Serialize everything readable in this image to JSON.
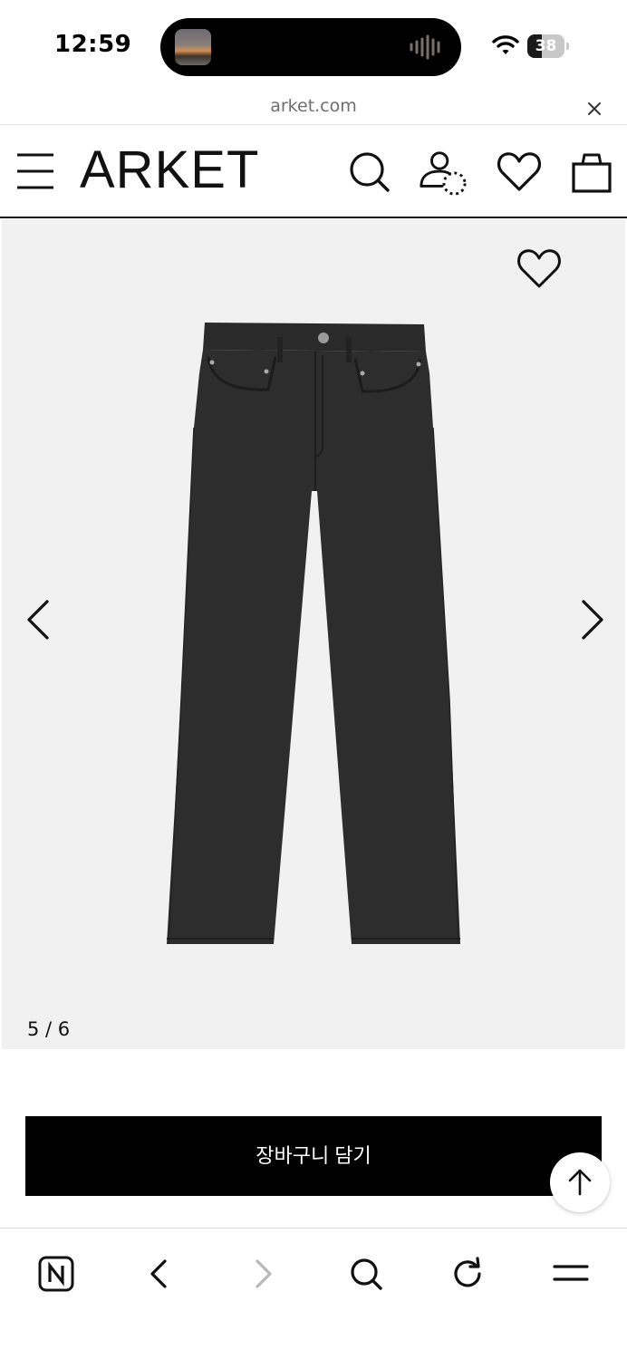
{
  "status_bar": {
    "time": "12:59",
    "battery_level": "38",
    "battery_fraction": 0.38
  },
  "browser": {
    "url": "arket.com"
  },
  "site": {
    "logo": "ARKET"
  },
  "gallery": {
    "counter": "5 / 6",
    "current_index": 5,
    "total": 6,
    "product_image": "black straight-leg jeans"
  },
  "product": {
    "add_to_cart_label": "장바구니 담기"
  },
  "colors": {
    "gallery_background": "#f1f1f1",
    "button_background": "#000000",
    "button_text": "#ffffff",
    "disabled_icon": "#b8b8b8"
  },
  "icons": {
    "header": [
      "menu-icon",
      "search-icon",
      "account-icon",
      "wishlist-icon",
      "shopping-bag-icon"
    ],
    "toolbar": [
      "naver-icon",
      "back-icon",
      "forward-icon",
      "search-icon",
      "refresh-icon",
      "menu-icon"
    ]
  }
}
